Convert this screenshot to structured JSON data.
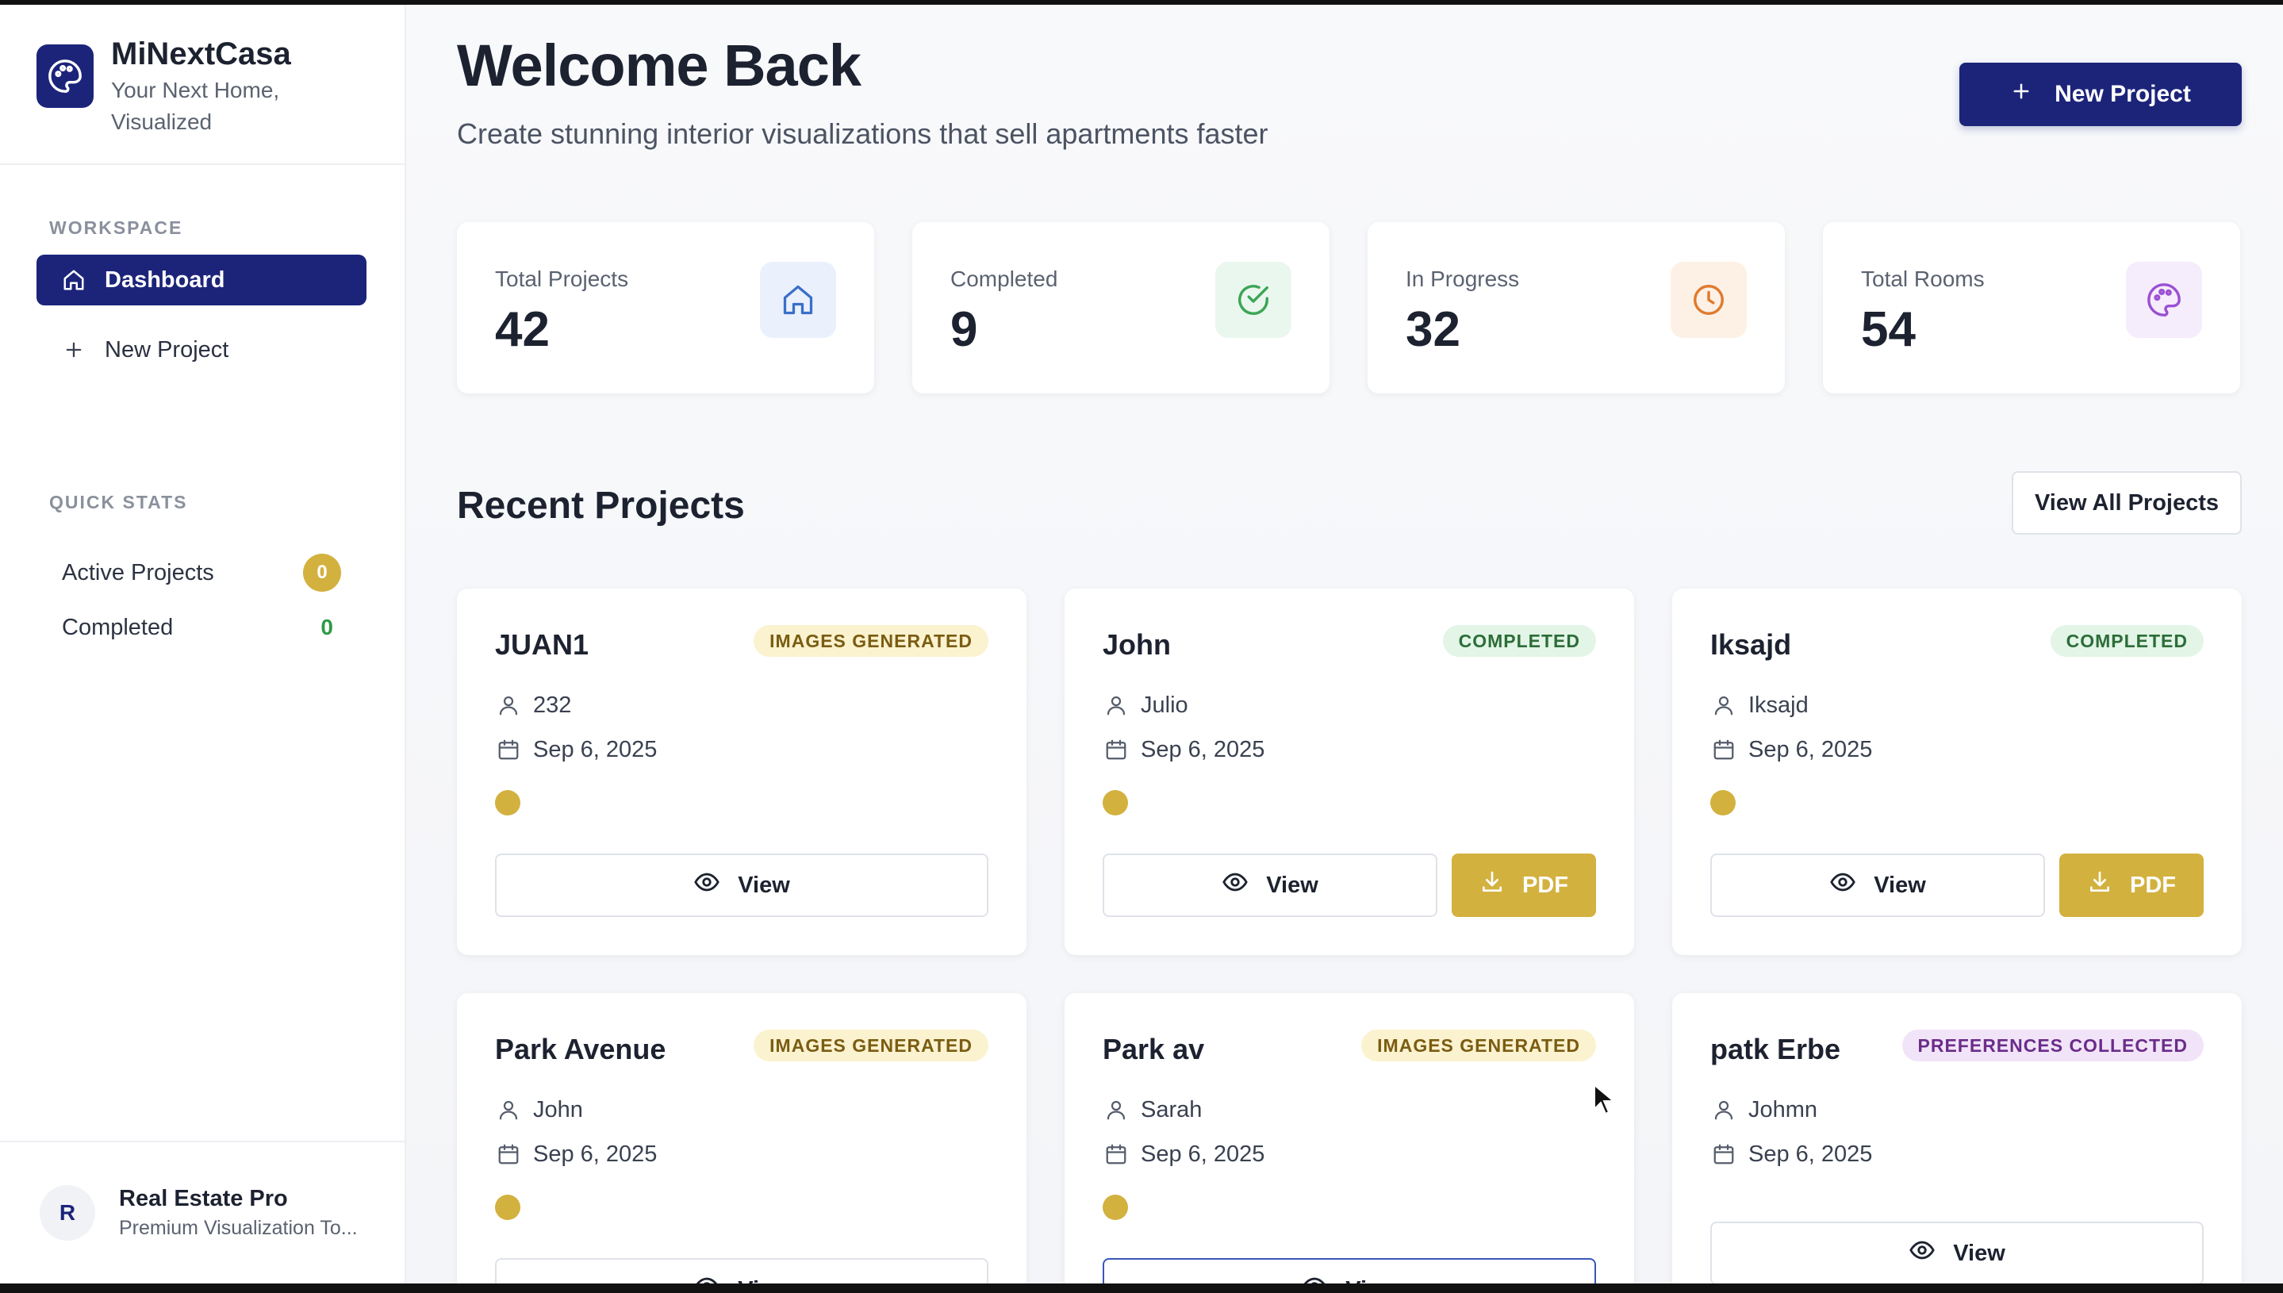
{
  "brand": {
    "name": "MiNextCasa",
    "tagline": "Your Next Home, Visualized"
  },
  "sidebar": {
    "workspace_label": "WORKSPACE",
    "items": [
      {
        "label": "Dashboard",
        "icon": "home-icon",
        "active": true
      },
      {
        "label": "New Project",
        "icon": "plus-icon",
        "active": false
      }
    ],
    "quick_stats_label": "QUICK STATS",
    "quick_stats": [
      {
        "label": "Active Projects",
        "value": "0"
      },
      {
        "label": "Completed",
        "value": "0"
      }
    ],
    "user": {
      "initial": "R",
      "name": "Real Estate Pro",
      "subtitle": "Premium Visualization To..."
    }
  },
  "header": {
    "title": "Welcome Back",
    "subtitle": "Create stunning interior visualizations that sell apartments faster",
    "new_project_label": "New Project"
  },
  "stats": [
    {
      "label": "Total Projects",
      "value": "42",
      "icon": "home-icon",
      "color": "#3b6fc9",
      "bg": "#eaf1fc"
    },
    {
      "label": "Completed",
      "value": "9",
      "icon": "check-circle-icon",
      "color": "#3aa655",
      "bg": "#eaf7ee"
    },
    {
      "label": "In Progress",
      "value": "32",
      "icon": "clock-icon",
      "color": "#e07a2e",
      "bg": "#fdf1e6"
    },
    {
      "label": "Total Rooms",
      "value": "54",
      "icon": "palette-icon",
      "color": "#9b4fd3",
      "bg": "#f5ecfc"
    }
  ],
  "recent": {
    "title": "Recent Projects",
    "view_all_label": "View All Projects",
    "view_label": "View",
    "pdf_label": "PDF",
    "projects": [
      {
        "name": "JUAN1",
        "status": "IMAGES GENERATED",
        "client": "232",
        "date": "Sep 6, 2025"
      },
      {
        "name": "John",
        "status": "COMPLETED",
        "client": "Julio",
        "date": "Sep 6, 2025"
      },
      {
        "name": "Iksajd",
        "status": "COMPLETED",
        "client": "Iksajd",
        "date": "Sep 6, 2025"
      },
      {
        "name": "Park Avenue",
        "status": "IMAGES GENERATED",
        "client": "John",
        "date": "Sep 6, 2025"
      },
      {
        "name": "Park av",
        "status": "IMAGES GENERATED",
        "client": "Sarah",
        "date": "Sep 6, 2025"
      },
      {
        "name": "patk Erbe",
        "status": "PREFERENCES COLLECTED",
        "client": "Johmn",
        "date": "Sep 6, 2025"
      }
    ]
  },
  "colors": {
    "brand": "#1c247a",
    "accent_gold": "#d3b13f",
    "success": "#2e9a46"
  }
}
